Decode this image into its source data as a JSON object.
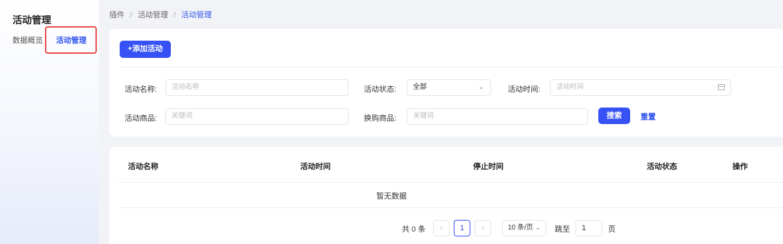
{
  "sidebar": {
    "title": "活动管理",
    "items": [
      {
        "label": "数据概览"
      },
      {
        "label": "活动管理"
      }
    ]
  },
  "breadcrumb": [
    "插件",
    "活动管理",
    "活动管理"
  ],
  "breadcrumb_separator": "/",
  "toolbar": {
    "add_label": "+添加活动"
  },
  "filters": {
    "name_label": "活动名称:",
    "name_placeholder": "活动名称",
    "status_label": "活动状态:",
    "status_value": "全部",
    "time_label": "活动时间:",
    "time_placeholder": "活动时间",
    "product_label": "活动商品:",
    "product_placeholder": "关键词",
    "swap_label": "换购商品:",
    "swap_placeholder": "关键词",
    "search_label": "搜索",
    "reset_label": "重置"
  },
  "table": {
    "columns": [
      "活动名称",
      "活动时间",
      "停止时间",
      "活动状态",
      "操作"
    ],
    "empty_text": "暂无数据"
  },
  "pagination": {
    "total_text": "共 0 条",
    "prev_glyph": "‹",
    "current_page": "1",
    "next_glyph": "›",
    "page_size": "10 条/页",
    "jump_label": "跳至",
    "jump_value": "1",
    "page_suffix": "页"
  },
  "colors": {
    "accent": "#3651f4",
    "highlight": "#e84a4a"
  },
  "icons": [
    "chevron-down-icon",
    "calendar-icon",
    "chevron-left-icon",
    "chevron-right-icon"
  ]
}
